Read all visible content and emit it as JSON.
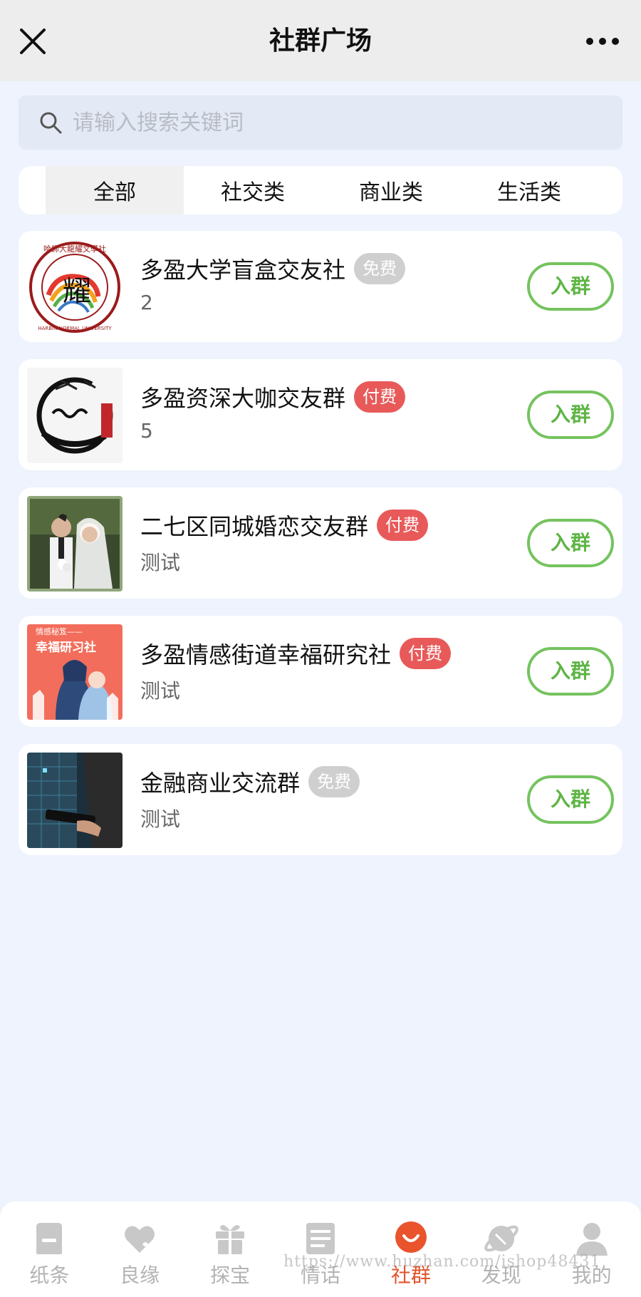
{
  "header": {
    "title": "社群广场"
  },
  "search": {
    "placeholder": "请输入搜索关键词"
  },
  "tabs": [
    {
      "label": "全部",
      "active": true
    },
    {
      "label": "社交类",
      "active": false
    },
    {
      "label": "商业类",
      "active": false
    },
    {
      "label": "生活类",
      "active": false
    }
  ],
  "groups": [
    {
      "name": "多盈大学盲盒交友社",
      "tag": "免费",
      "tag_type": "free",
      "subtitle": "2",
      "join_label": "入群"
    },
    {
      "name": "多盈资深大咖交友群",
      "tag": "付费",
      "tag_type": "paid",
      "subtitle": "5",
      "join_label": "入群"
    },
    {
      "name": "二七区同城婚恋交友群",
      "tag": "付费",
      "tag_type": "paid",
      "subtitle": "测试",
      "join_label": "入群"
    },
    {
      "name": "多盈情感街道幸福研究社",
      "tag": "付费",
      "tag_type": "paid",
      "subtitle": "测试",
      "join_label": "入群"
    },
    {
      "name": "金融商业交流群",
      "tag": "免费",
      "tag_type": "free",
      "subtitle": "测试",
      "join_label": "入群"
    }
  ],
  "thumbnails": {
    "logo_text_1": "耀",
    "logo_ring_text_1": "哈師大龍耀文學社",
    "logo_ring_text_1b": "HARBIN NORMAL UNIVERSITY",
    "poster_line_1": "情感秘笈——",
    "poster_line_2": "幸福研习社"
  },
  "bottom_nav": [
    {
      "label": "纸条",
      "icon": "note-icon",
      "active": false
    },
    {
      "label": "良缘",
      "icon": "heart-icon",
      "active": false
    },
    {
      "label": "探宝",
      "icon": "gift-icon",
      "active": false
    },
    {
      "label": "情话",
      "icon": "message-icon",
      "active": false
    },
    {
      "label": "社群",
      "icon": "group-icon",
      "active": true
    },
    {
      "label": "发现",
      "icon": "planet-icon",
      "active": false
    },
    {
      "label": "我的",
      "icon": "user-icon",
      "active": false
    }
  ],
  "watermark": "https://www.huzhan.com/ishop48431",
  "colors": {
    "background": "#eef3fd",
    "join_green": "#75c35f",
    "paid_red": "#e85a5a",
    "free_gray": "#cfcfcf",
    "nav_active": "#e0542b",
    "nav_inactive": "#b3b3b3"
  }
}
